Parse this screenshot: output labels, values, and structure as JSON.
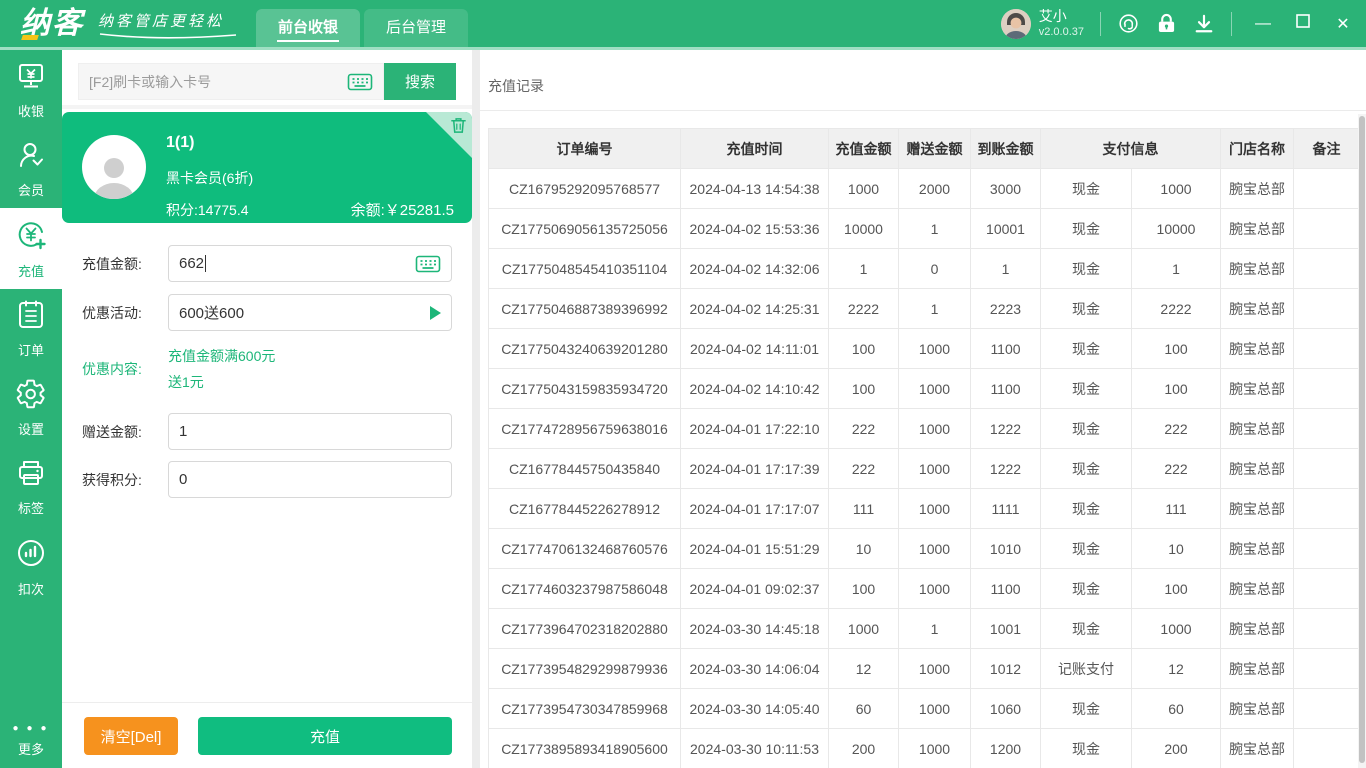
{
  "topbar": {
    "logo": "纳客",
    "slogan": "纳客管店更轻松",
    "tabs": [
      {
        "label": "前台收银"
      },
      {
        "label": "后台管理"
      }
    ],
    "user": {
      "name": "艾小",
      "version": "v2.0.0.37"
    },
    "icons": [
      "customer-service-icon",
      "lock-icon",
      "download-icon"
    ]
  },
  "sidebar": {
    "items": [
      {
        "label": "收银",
        "icon": "cashier-icon"
      },
      {
        "label": "会员",
        "icon": "member-icon"
      },
      {
        "label": "充值",
        "icon": "recharge-icon"
      },
      {
        "label": "订单",
        "icon": "orders-icon"
      },
      {
        "label": "设置",
        "icon": "settings-icon"
      },
      {
        "label": "标签",
        "icon": "label-printer-icon"
      },
      {
        "label": "扣次",
        "icon": "deduct-count-icon"
      }
    ],
    "more_label": "更多"
  },
  "member_panel": {
    "search": {
      "placeholder": "[F2]刷卡或输入卡号",
      "button": "搜索"
    },
    "card": {
      "name": "1(1)",
      "level": "黑卡会员(6折)",
      "points": "积分:14775.4",
      "balance": "余额:￥25281.5"
    },
    "form": {
      "recharge_amount": {
        "label": "充值金额:",
        "value": "662"
      },
      "promo_activity": {
        "label": "优惠活动:",
        "value": "600送600"
      },
      "promo_content": {
        "label": "优惠内容:",
        "line1": "充值金额满600元",
        "line2": "送1元"
      },
      "gift_amount": {
        "label": "赠送金额:",
        "value": "1"
      },
      "points_gain": {
        "label": "获得积分:",
        "value": "0"
      }
    },
    "actions": {
      "clear": "清空[Del]",
      "recharge": "充值"
    }
  },
  "records": {
    "title": "充值记录",
    "columns": [
      "订单编号",
      "充值时间",
      "充值金额",
      "赠送金额",
      "到账金额",
      "支付信息",
      "门店名称",
      "备注"
    ],
    "rows": [
      [
        "CZ16795292095768577",
        "2024-04-13 14:54:38",
        "1000",
        "2000",
        "3000",
        "现金",
        "1000",
        "腕宝总部",
        ""
      ],
      [
        "CZ1775069056135725056",
        "2024-04-02 15:53:36",
        "10000",
        "1",
        "10001",
        "现金",
        "10000",
        "腕宝总部",
        ""
      ],
      [
        "CZ1775048545410351104",
        "2024-04-02 14:32:06",
        "1",
        "0",
        "1",
        "现金",
        "1",
        "腕宝总部",
        ""
      ],
      [
        "CZ1775046887389396992",
        "2024-04-02 14:25:31",
        "2222",
        "1",
        "2223",
        "现金",
        "2222",
        "腕宝总部",
        ""
      ],
      [
        "CZ1775043240639201280",
        "2024-04-02 14:11:01",
        "100",
        "1000",
        "1100",
        "现金",
        "100",
        "腕宝总部",
        ""
      ],
      [
        "CZ1775043159835934720",
        "2024-04-02 14:10:42",
        "100",
        "1000",
        "1100",
        "现金",
        "100",
        "腕宝总部",
        ""
      ],
      [
        "CZ1774728956759638016",
        "2024-04-01 17:22:10",
        "222",
        "1000",
        "1222",
        "现金",
        "222",
        "腕宝总部",
        ""
      ],
      [
        "CZ16778445750435840",
        "2024-04-01 17:17:39",
        "222",
        "1000",
        "1222",
        "现金",
        "222",
        "腕宝总部",
        ""
      ],
      [
        "CZ16778445226278912",
        "2024-04-01 17:17:07",
        "111",
        "1000",
        "1111",
        "现金",
        "111",
        "腕宝总部",
        ""
      ],
      [
        "CZ1774706132468760576",
        "2024-04-01 15:51:29",
        "10",
        "1000",
        "1010",
        "现金",
        "10",
        "腕宝总部",
        ""
      ],
      [
        "CZ1774603237987586048",
        "2024-04-01 09:02:37",
        "100",
        "1000",
        "1100",
        "现金",
        "100",
        "腕宝总部",
        ""
      ],
      [
        "CZ1773964702318202880",
        "2024-03-30 14:45:18",
        "1000",
        "1",
        "1001",
        "现金",
        "1000",
        "腕宝总部",
        ""
      ],
      [
        "CZ1773954829299879936",
        "2024-03-30 14:06:04",
        "12",
        "1000",
        "1012",
        "记账支付",
        "12",
        "腕宝总部",
        ""
      ],
      [
        "CZ1773954730347859968",
        "2024-03-30 14:05:40",
        "60",
        "1000",
        "1060",
        "现金",
        "60",
        "腕宝总部",
        ""
      ],
      [
        "CZ1773895893418905600",
        "2024-03-30 10:11:53",
        "200",
        "1000",
        "1200",
        "现金",
        "200",
        "腕宝总部",
        ""
      ]
    ]
  },
  "colors": {
    "brand_green": "#2bb377",
    "card_green": "#0fbc7d",
    "accent_green": "#1db679",
    "button_orange": "#f6921e",
    "table_header_bg": "#f0f0f0"
  }
}
